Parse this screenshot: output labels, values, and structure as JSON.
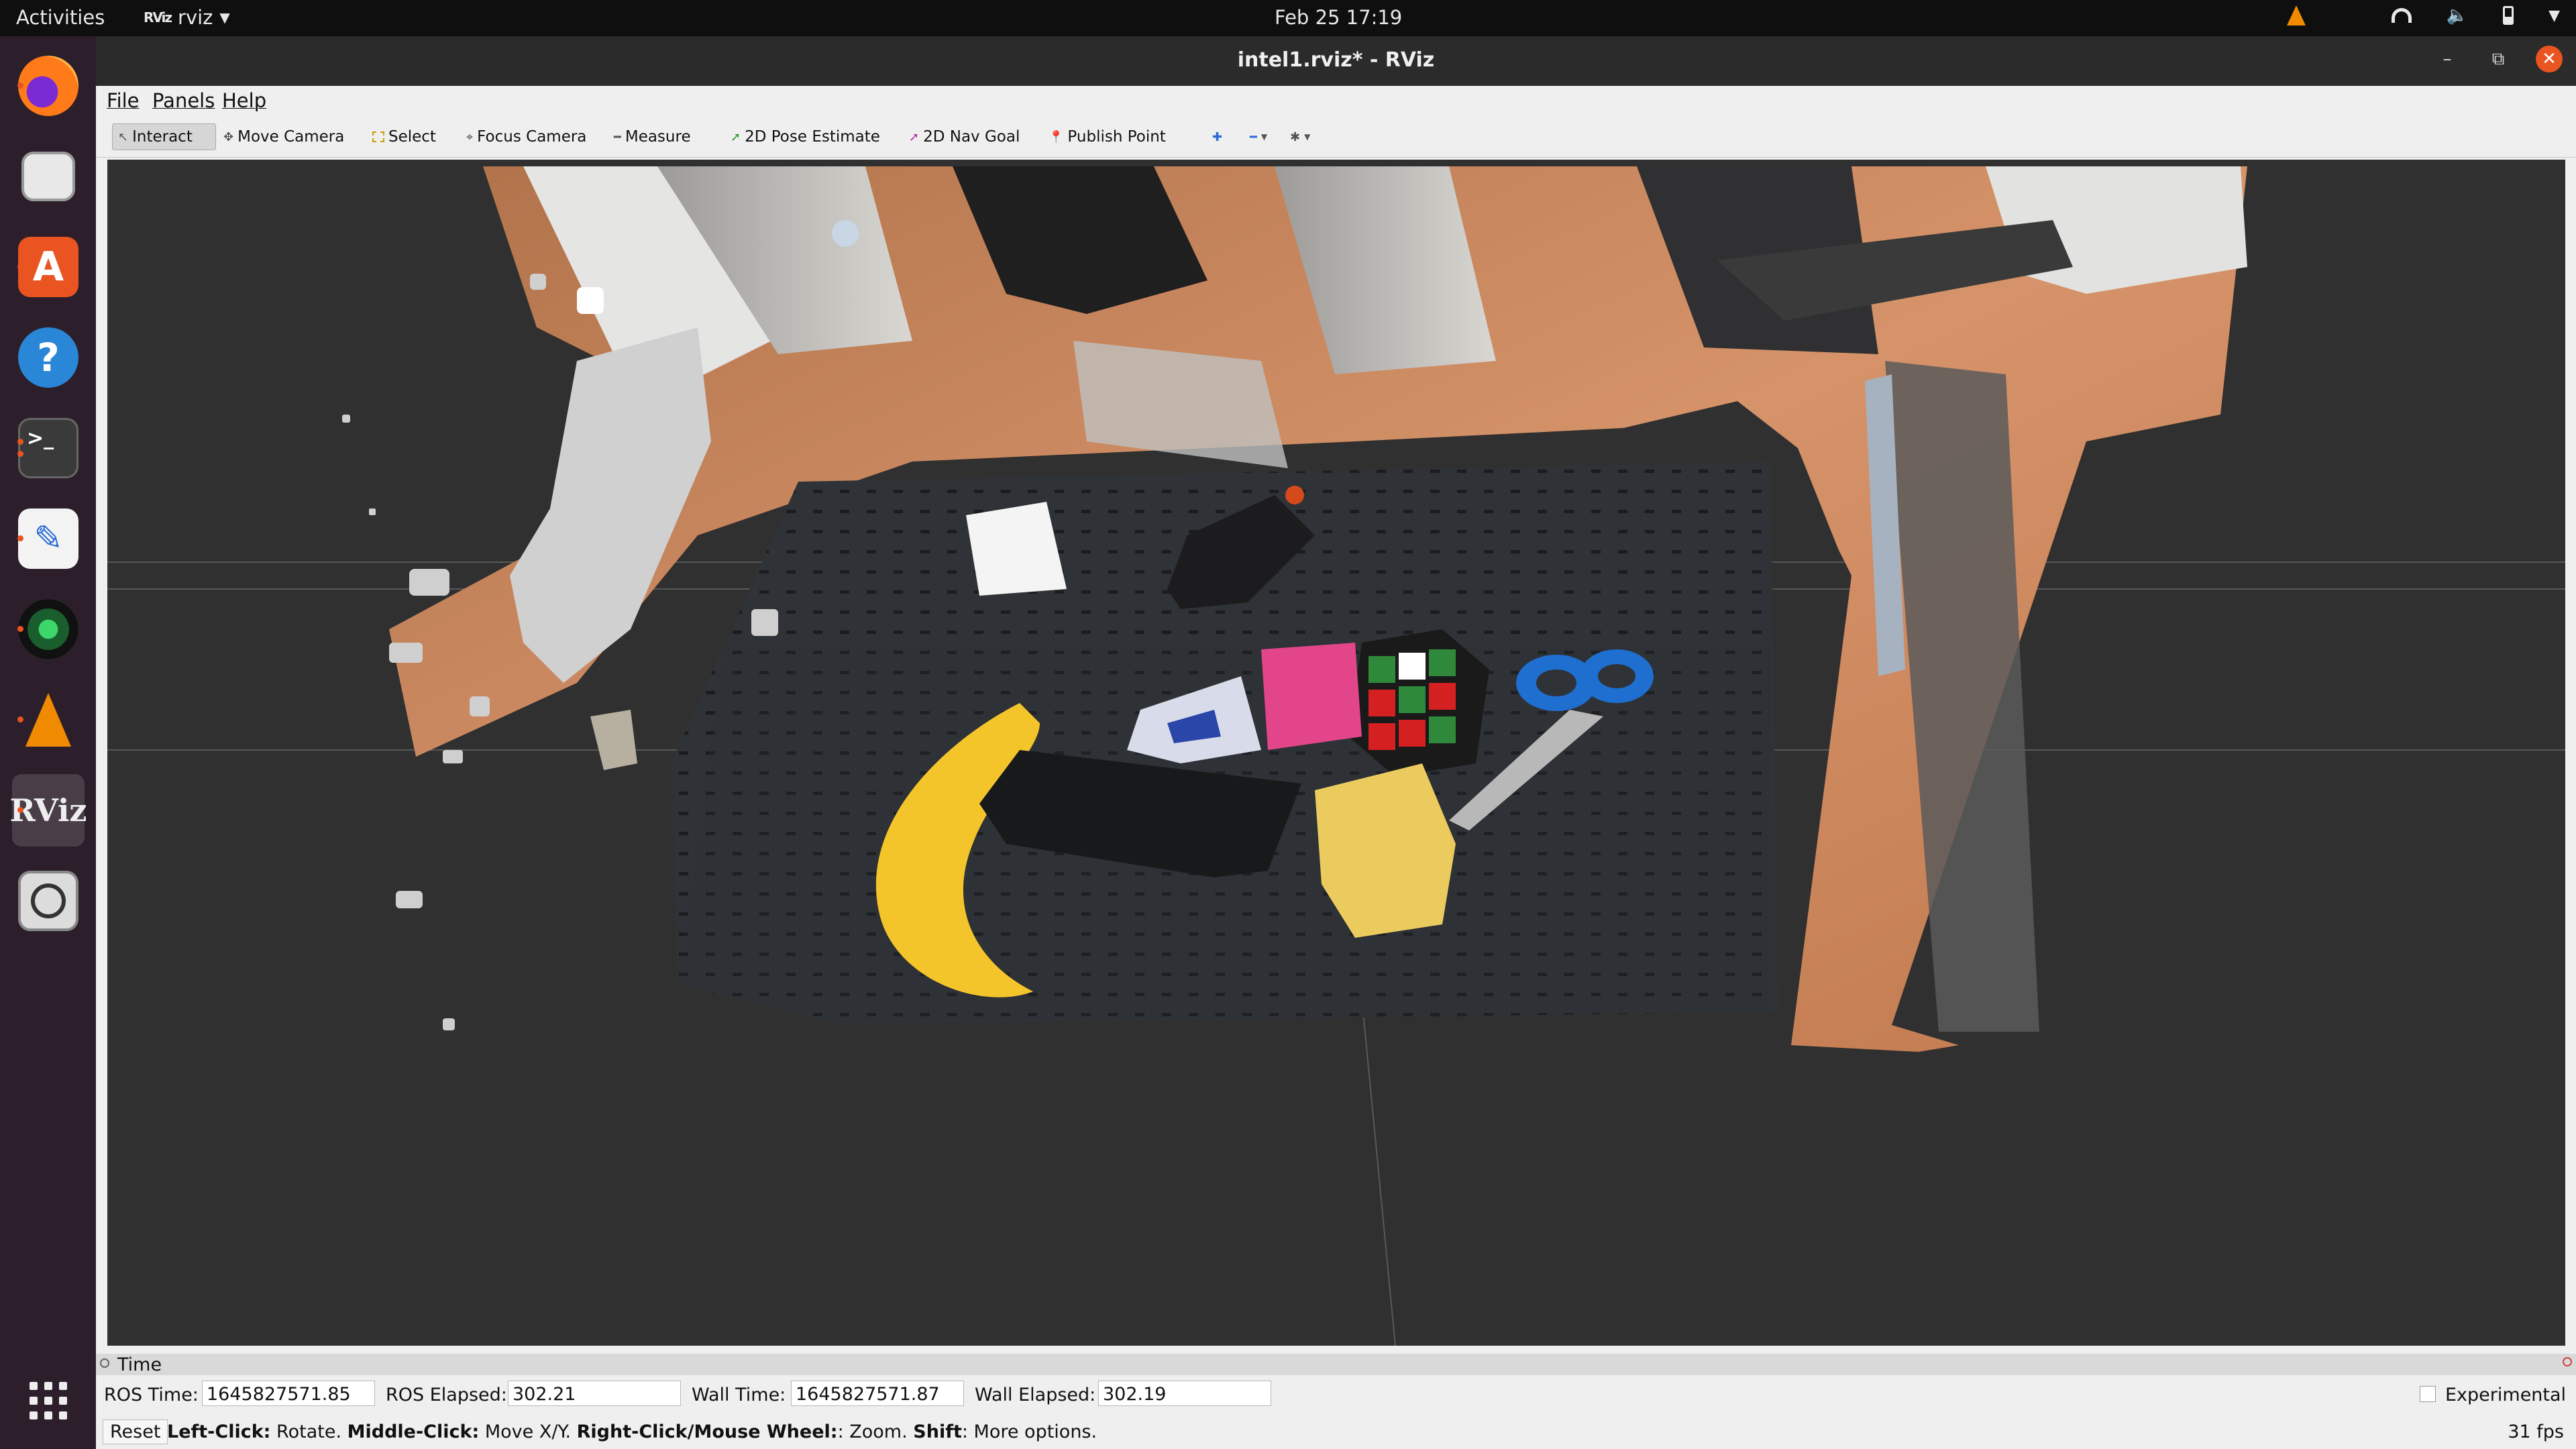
{
  "topbar": {
    "activities": "Activities",
    "app_name": "rviz",
    "app_logo_text": "RViz",
    "clock": "Feb 25  17:19",
    "tray_icons": [
      "vlc-icon",
      "globe-icon",
      "wifi-icon",
      "volume-icon",
      "battery-icon",
      "system-menu-icon"
    ]
  },
  "dock": {
    "items": [
      "firefox",
      "files",
      "app-center",
      "help",
      "terminal",
      "text-editor",
      "camera",
      "vlc",
      "rviz",
      "magnifier",
      "show-apps"
    ],
    "rviz_label": "RViz",
    "terminal_label": ">_"
  },
  "window": {
    "title": "intel1.rviz* - RViz"
  },
  "menubar": {
    "file": "File",
    "panels": "Panels",
    "help": "Help"
  },
  "toolbar": {
    "interact": "Interact",
    "move_camera": "Move Camera",
    "select": "Select",
    "focus_camera": "Focus Camera",
    "measure": "Measure",
    "pose_estimate": "2D Pose Estimate",
    "nav_goal": "2D Nav Goal",
    "publish_point": "Publish Point",
    "active_tool": "Interact"
  },
  "time_panel": {
    "title": "Time",
    "ros_time_label": "ROS Time:",
    "ros_time": "1645827571.85",
    "ros_elapsed_label": "ROS Elapsed:",
    "ros_elapsed": "302.21",
    "wall_time_label": "Wall Time:",
    "wall_time": "1645827571.87",
    "wall_elapsed_label": "Wall Elapsed:",
    "wall_elapsed": "302.19",
    "experimental_label": "Experimental",
    "experimental_checked": false
  },
  "statusbar": {
    "reset": "Reset",
    "left_click_key": "Left-Click:",
    "left_click_text": " Rotate. ",
    "middle_click_key": "Middle-Click:",
    "middle_click_text": " Move X/Y. ",
    "right_click_key": "Right-Click/Mouse Wheel:",
    "right_click_text": ": Zoom. ",
    "shift_key": "Shift",
    "shift_text": ": More options.",
    "fps": "31 fps"
  },
  "colors": {
    "accent": "#e95420",
    "dock_bg": "#2c1f2b",
    "viewport_bg": "#303030",
    "floor": "#c9865a",
    "table": "#2f3236"
  }
}
